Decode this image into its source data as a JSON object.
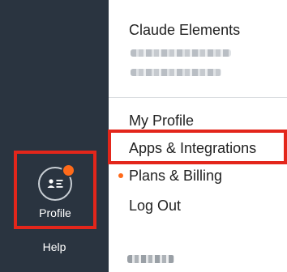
{
  "sidebar": {
    "profile_label": "Profile",
    "help_label": "Help",
    "profile_icon": "profile-card-icon",
    "notification": true
  },
  "menu": {
    "account_name": "Claude Elements",
    "items": [
      {
        "label": "My Profile"
      },
      {
        "label": "Apps & Integrations",
        "highlighted": true
      },
      {
        "label": "Plans & Billing",
        "bullet": true
      },
      {
        "label": "Log Out"
      }
    ]
  },
  "colors": {
    "sidebar_bg": "#2a3440",
    "highlight": "#e3261b",
    "notification": "#ff6a1a"
  }
}
